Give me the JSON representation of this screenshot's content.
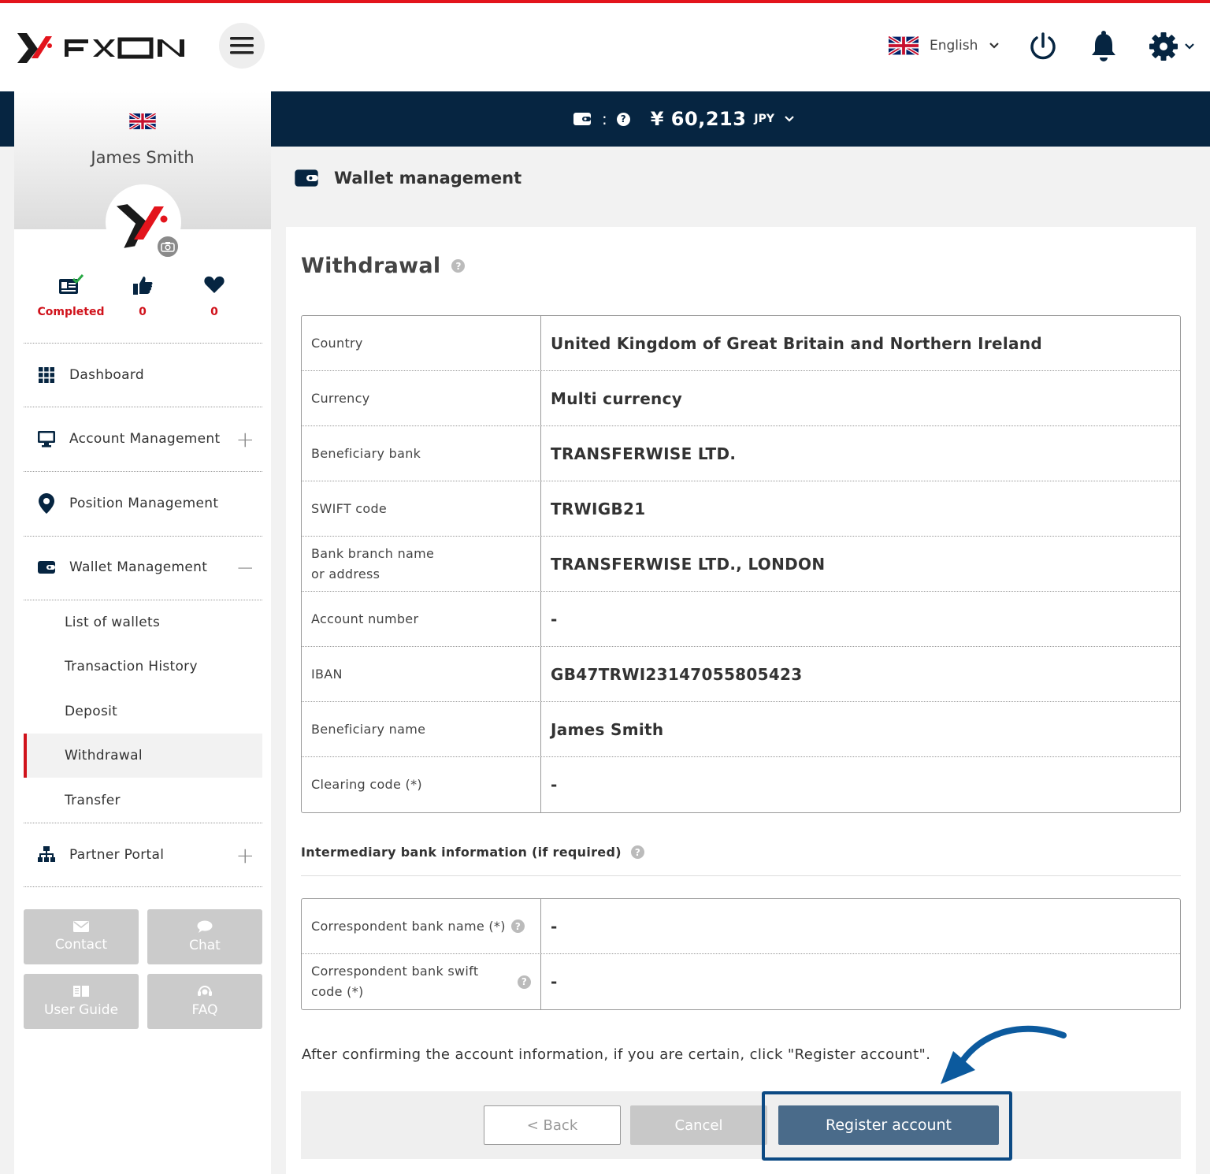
{
  "header": {
    "brand": "FXON",
    "language": "English"
  },
  "balance": {
    "colon": ":",
    "amount": "¥ 60,213",
    "currency": "JPY"
  },
  "profile": {
    "name": "James Smith",
    "verification_label": "Completed",
    "likes": "0",
    "favorites": "0"
  },
  "sidebar": {
    "items": [
      {
        "label": "Dashboard",
        "icon": "dashboard-grid-icon"
      },
      {
        "label": "Account Management",
        "icon": "monitor-icon",
        "toggle": "+"
      },
      {
        "label": "Position Management",
        "icon": "map-pin-icon"
      },
      {
        "label": "Wallet Management",
        "icon": "wallet-icon",
        "toggle": "−"
      },
      {
        "label": "Partner Portal",
        "icon": "sitemap-icon",
        "toggle": "+"
      }
    ],
    "wallet_sub": [
      {
        "label": "List of wallets"
      },
      {
        "label": "Transaction History"
      },
      {
        "label": "Deposit"
      },
      {
        "label": "Withdrawal",
        "active": true
      },
      {
        "label": "Transfer"
      }
    ],
    "buttons": [
      {
        "label": "Contact",
        "icon": "envelope-icon"
      },
      {
        "label": "Chat",
        "icon": "chat-bubble-icon"
      },
      {
        "label": "User Guide",
        "icon": "book-icon"
      },
      {
        "label": "FAQ",
        "icon": "headset-icon"
      }
    ]
  },
  "page": {
    "title": "Wallet management",
    "card_title": "Withdrawal"
  },
  "bank_table": [
    {
      "label": "Country",
      "value": "United Kingdom of Great Britain and Northern Ireland"
    },
    {
      "label": "Currency",
      "value": "Multi currency"
    },
    {
      "label": "Beneficiary bank",
      "value": "TRANSFERWISE LTD."
    },
    {
      "label": "SWIFT code",
      "value": "TRWIGB21"
    },
    {
      "label": "Bank branch name\nor address",
      "value": "TRANSFERWISE LTD., LONDON"
    },
    {
      "label": "Account number",
      "value": "-"
    },
    {
      "label": "IBAN",
      "value": "GB47TRWI23147055805423"
    },
    {
      "label": "Beneficiary name",
      "value": "James Smith"
    },
    {
      "label": "Clearing code (*)",
      "value": "-"
    }
  ],
  "intermediary": {
    "title": "Intermediary bank information (if required)",
    "rows": [
      {
        "label": "Correspondent bank name (*)",
        "value": "-"
      },
      {
        "label": "Correspondent bank swift\ncode (*)",
        "value": "-"
      }
    ]
  },
  "note": "After confirming the account information, if you are certain, click \"Register account\".",
  "actions": {
    "back": "< Back",
    "cancel": "Cancel",
    "register": "Register account"
  },
  "colors": {
    "brand_red": "#e3141c",
    "navy": "#062541",
    "register_button": "#4a6b8a",
    "highlight_border": "#0c4a84"
  }
}
